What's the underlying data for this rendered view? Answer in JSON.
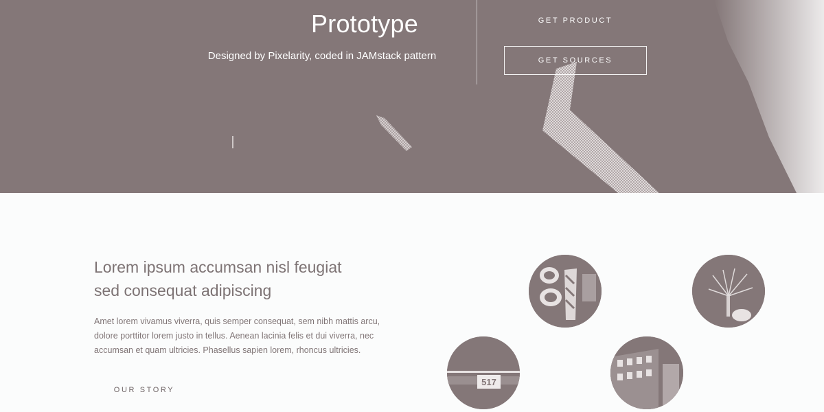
{
  "hero": {
    "title": "Prototype",
    "subtitle": "Designed by Pixelarity, coded in JAMstack pattern",
    "get_product_label": "GET PRODUCT",
    "get_sources_label": "GET SOURCES"
  },
  "intro": {
    "heading_line1": "Lorem ipsum accumsan nisl feugiat",
    "heading_line2": "sed consequat adipiscing",
    "body": "Amet lorem vivamus viverra, quis semper consequat, sem nibh mattis arcu, dolore porttitor lorem justo in tellus. Aenean lacinia felis et dui viverra, nec accumsan et quam ultricies. Phasellus sapien lorem, rhoncus ultricies.",
    "story_label": "OUR STORY"
  },
  "gallery": {
    "sign_text": "517"
  },
  "colors": {
    "hero_background": "#847778",
    "page_background": "#fbfcfc",
    "heading_text": "#7d7374"
  }
}
